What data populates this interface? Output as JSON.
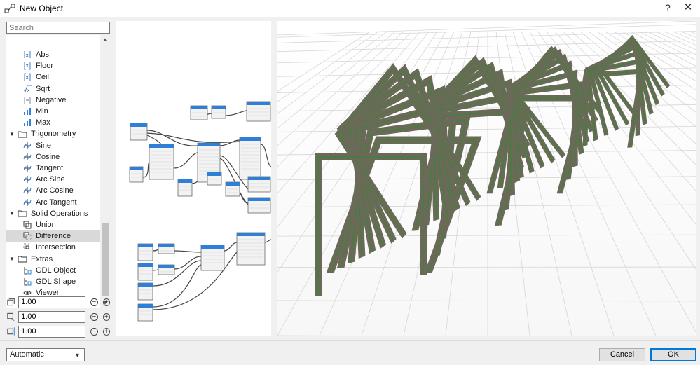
{
  "window": {
    "title": "New Object",
    "help_label": "?",
    "close_label": "✕"
  },
  "search": {
    "placeholder": "Search"
  },
  "tree": [
    {
      "label": "Abs",
      "icon": "abs-icon",
      "type": "child"
    },
    {
      "label": "Floor",
      "icon": "floor-icon",
      "type": "child"
    },
    {
      "label": "Ceil",
      "icon": "ceil-icon",
      "type": "child"
    },
    {
      "label": "Sqrt",
      "icon": "sqrt-icon",
      "type": "child"
    },
    {
      "label": "Negative",
      "icon": "negative-icon",
      "type": "child"
    },
    {
      "label": "Min",
      "icon": "min-icon",
      "type": "child"
    },
    {
      "label": "Max",
      "icon": "max-icon",
      "type": "child"
    },
    {
      "label": "Trigonometry",
      "icon": "folder-icon",
      "type": "group"
    },
    {
      "label": "Sine",
      "icon": "sine-icon",
      "type": "child"
    },
    {
      "label": "Cosine",
      "icon": "cosine-icon",
      "type": "child"
    },
    {
      "label": "Tangent",
      "icon": "tangent-icon",
      "type": "child"
    },
    {
      "label": "Arc Sine",
      "icon": "arc-sine-icon",
      "type": "child"
    },
    {
      "label": "Arc Cosine",
      "icon": "arc-cosine-icon",
      "type": "child"
    },
    {
      "label": "Arc Tangent",
      "icon": "arc-tangent-icon",
      "type": "child"
    },
    {
      "label": "Solid Operations",
      "icon": "folder-icon",
      "type": "group"
    },
    {
      "label": "Union",
      "icon": "union-icon",
      "type": "child"
    },
    {
      "label": "Difference",
      "icon": "difference-icon",
      "type": "child",
      "selected": true
    },
    {
      "label": "Intersection",
      "icon": "intersection-icon",
      "type": "child"
    },
    {
      "label": "Extras",
      "icon": "folder-icon",
      "type": "group"
    },
    {
      "label": "GDL Object",
      "icon": "gdl-object-icon",
      "type": "child"
    },
    {
      "label": "GDL Shape",
      "icon": "gdl-shape-icon",
      "type": "child"
    },
    {
      "label": "Viewer",
      "icon": "eye-icon",
      "type": "child"
    }
  ],
  "dimensions": {
    "x": "1.00",
    "y": "1.00",
    "z": "1.00",
    "minus": "−",
    "plus": "+"
  },
  "footer": {
    "mode": "Automatic",
    "cancel_label": "Cancel",
    "ok_label": "OK"
  },
  "colors": {
    "accent": "#0078d7",
    "node_header": "#2f7fd8",
    "wireframe": "#2e8b2e",
    "timber": "#6b6a58"
  }
}
